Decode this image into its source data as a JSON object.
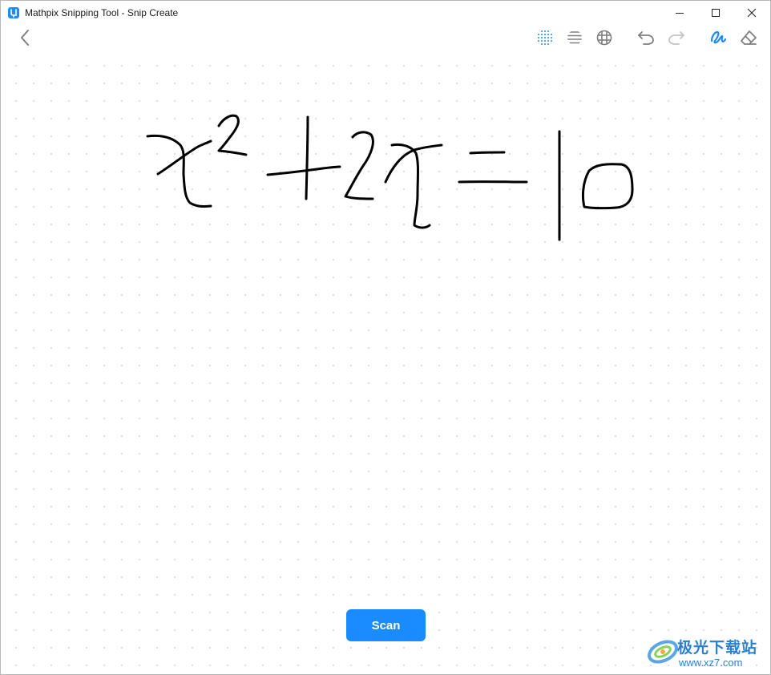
{
  "window": {
    "title": "Mathpix Snipping Tool - Snip Create"
  },
  "titlebar": {
    "icons": [
      "mathpix-app-icon",
      "minimize-icon",
      "maximize-icon",
      "close-icon"
    ]
  },
  "toolbar": {
    "icons": [
      "back-chevron-icon",
      "dot-grid-icon",
      "lined-paper-icon",
      "square-grid-icon",
      "undo-icon",
      "redo-icon",
      "pen-icon",
      "eraser-icon"
    ],
    "active_background": "dot-grid",
    "active_tool": "pen"
  },
  "canvas": {
    "handwritten_expression": "x^2+2x=10"
  },
  "scan": {
    "label": "Scan"
  },
  "watermark": {
    "brand": "极光下载站",
    "url": "www.xz7.com"
  },
  "colors": {
    "accent": "#1a8cff",
    "ink": "#000000",
    "icon_gray": "#7f7f7f",
    "icon_disabled": "#c4c4c4",
    "watermark": "#2a7fd0"
  }
}
